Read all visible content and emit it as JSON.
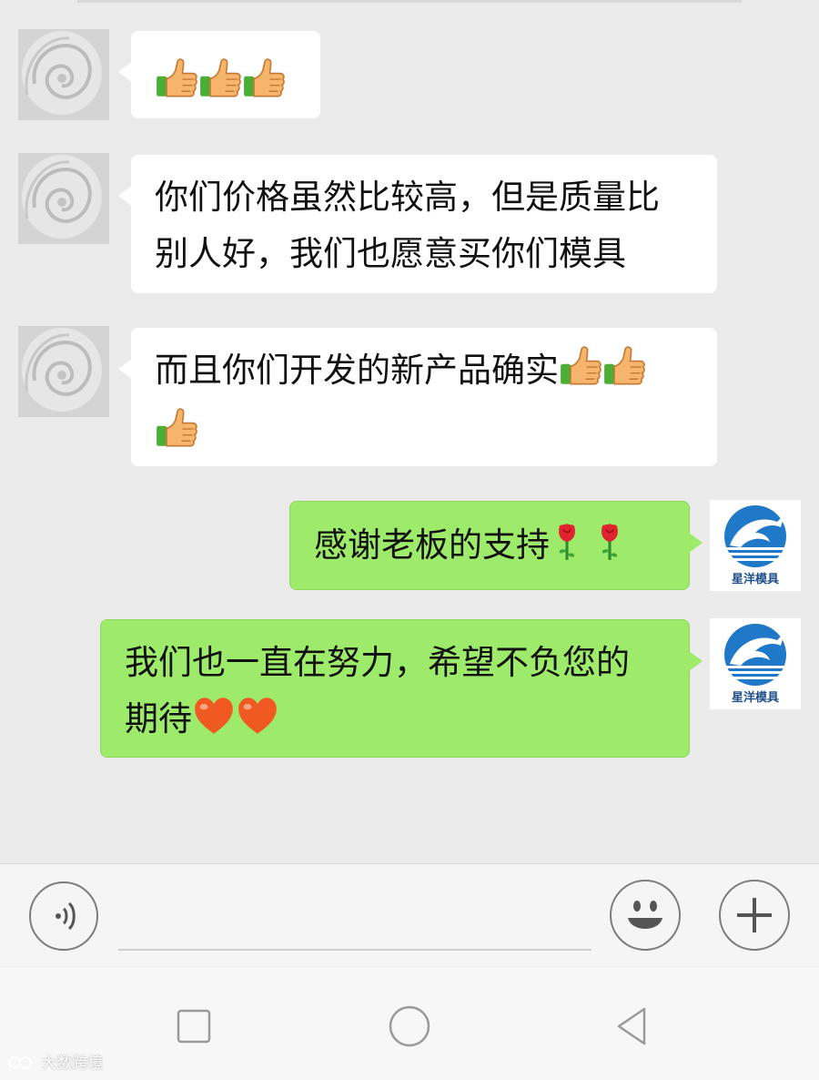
{
  "messages": [
    {
      "side": "left",
      "parts": [
        "",
        "",
        ""
      ],
      "emojis": [
        "thumbs-up-emoji",
        "thumbs-up-emoji",
        "thumbs-up-emoji"
      ]
    },
    {
      "side": "left",
      "line1": "你们价格虽然比较高，但是质量比",
      "line2": "别人好，我们也愿意买你们模具"
    },
    {
      "side": "left",
      "line1": "而且你们开发的新产品确实",
      "emojis": [
        "thumbs-up-emoji",
        "thumbs-up-emoji",
        "thumbs-up-emoji"
      ]
    },
    {
      "side": "right",
      "line1": "感谢老板的支持",
      "emojis": [
        "rose-emoji",
        "rose-emoji"
      ]
    },
    {
      "side": "right",
      "line1": "我们也一直在努力，希望不负您的",
      "line2": "期待",
      "emojis": [
        "heart-emoji",
        "heart-emoji"
      ]
    }
  ],
  "avatar_logo_text": "星洋模具",
  "input_bar": {
    "icons": [
      "voice-icon",
      "emoji-icon",
      "plus-icon"
    ]
  },
  "nav_bar": {
    "icons": [
      "recent-apps-icon",
      "home-icon",
      "back-icon"
    ]
  },
  "watermark": "大数跨境",
  "colors": {
    "background": "#ebebeb",
    "incoming_bubble": "#ffffff",
    "outgoing_bubble": "#9eea6a",
    "logo_blue": "#1f78c8"
  }
}
